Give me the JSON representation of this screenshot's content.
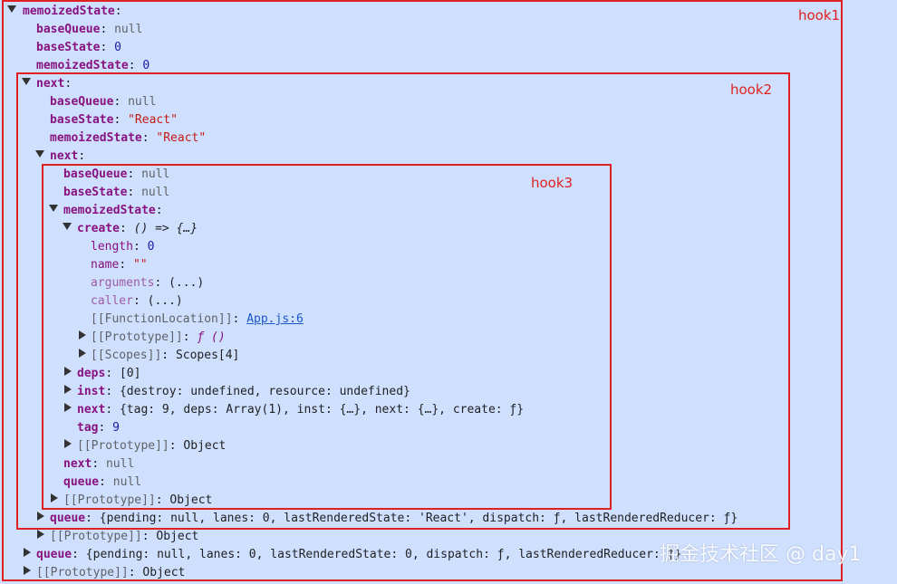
{
  "labels": {
    "hook1": "hook1",
    "hook2": "hook2",
    "hook3": "hook3"
  },
  "watermark": "掘金技术社区 @ day1",
  "t": {
    "memoizedState": "memoizedState",
    "baseQueue": "baseQueue",
    "baseState": "baseState",
    "next": "next",
    "queue": "queue",
    "create": "create",
    "deps": "deps",
    "inst": "inst",
    "tag": "tag",
    "length": "length",
    "name": "name",
    "arguments": "arguments",
    "caller": "caller",
    "functionLocation": "[[FunctionLocation]]",
    "prototype": "[[Prototype]]",
    "scopes": "[[Scopes]]"
  },
  "v": {
    "null": "null",
    "zero": "0",
    "react_str": "\"React\"",
    "create_fn": "() => {…}",
    "empty_str": "\"\"",
    "ellipsis": "(...)",
    "app_link": "App.js:6",
    "f_proto": "ƒ ()",
    "scopes4": "Scopes[4]",
    "deps_val": "[0]",
    "inst_val": "{destroy: undefined, resource: undefined}",
    "next_effect": "{tag: 9, deps: Array(1), inst: {…}, next: {…}, create: ƒ}",
    "tag_val": "9",
    "object": "Object",
    "queue2": "{pending: null, lanes: 0, lastRenderedState: 'React', dispatch: ƒ, lastRenderedReducer: ƒ}",
    "queue1": "{pending: null, lanes: 0, lastRenderedState: 0, dispatch: ƒ, lastRenderedReducer: ƒ}"
  }
}
